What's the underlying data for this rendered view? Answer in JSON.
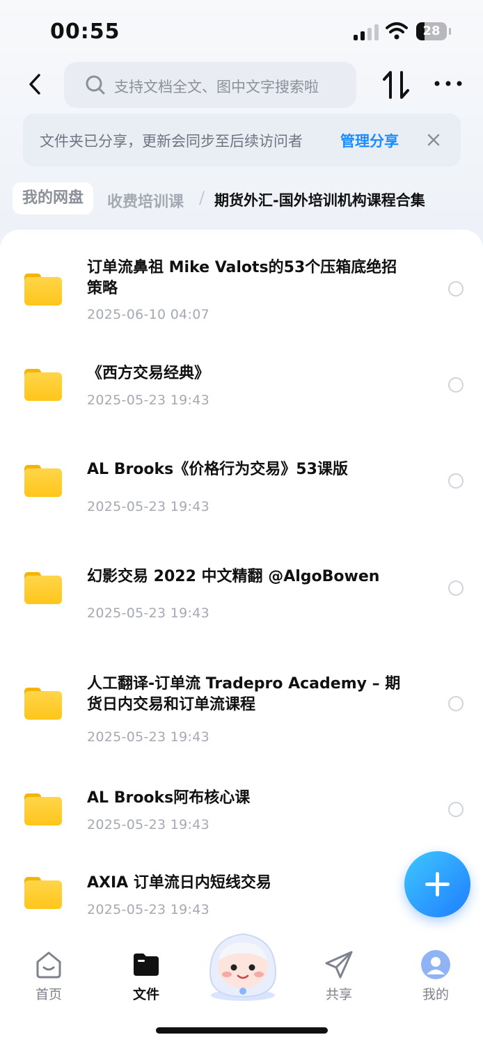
{
  "status_bar": {
    "time": "00:55",
    "battery": "28",
    "battery_level": 0.28
  },
  "search": {
    "placeholder": "支持文档全文、图中文字搜索啦"
  },
  "banner": {
    "text": "文件夹已分享，更新会同步至后续访问者",
    "manage_label": "管理分享"
  },
  "breadcrumb": {
    "root": "我的网盘",
    "middle": "收费培训课",
    "separator": "/",
    "current": "期货外汇-国外培训机构课程合集"
  },
  "files": [
    {
      "name": "订单流鼻祖 Mike Valots的53个压箱底绝招策略",
      "date": "2025-06-10 04:07"
    },
    {
      "name": "《西方交易经典》",
      "date": "2025-05-23 19:43"
    },
    {
      "name": "AL Brooks《价格行为交易》53课版",
      "date": "2025-05-23 19:43"
    },
    {
      "name": "幻影交易 2022 中文精翻 @AlgoBowen",
      "date": "2025-05-23 19:43"
    },
    {
      "name": "人工翻译-订单流 Tradepro Academy – 期货日内交易和订单流课程",
      "date": "2025-05-23 19:43"
    },
    {
      "name": "AL Brooks阿布核心课",
      "date": "2025-05-23 19:43"
    },
    {
      "name": "AXIA 订单流日内短线交易",
      "date": "2025-05-23 19:43"
    }
  ],
  "tabbar": {
    "home": "首页",
    "files": "文件",
    "share": "共享",
    "mine": "我的"
  },
  "colors": {
    "accent": "#1a8cff",
    "folder": "#ffc61a",
    "fab_start": "#3ec7ff",
    "fab_end": "#1f7dff"
  }
}
